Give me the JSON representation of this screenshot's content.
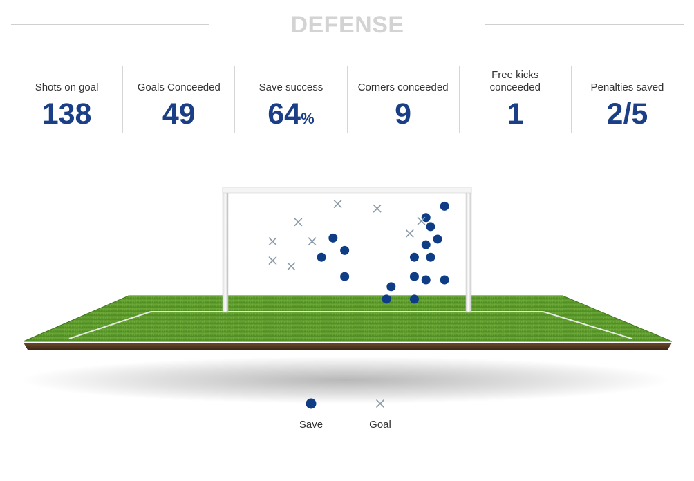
{
  "section": {
    "title": "DEFENSE"
  },
  "stats": [
    {
      "label": "Shots on goal",
      "value": "138",
      "unit": ""
    },
    {
      "label": "Goals Conceeded",
      "value": "49",
      "unit": ""
    },
    {
      "label": "Save success",
      "value": "64",
      "unit": "%"
    },
    {
      "label": "Corners conceeded",
      "value": "9",
      "unit": ""
    },
    {
      "label": "Free kicks conceeded",
      "value": "1",
      "unit": ""
    },
    {
      "label": "Penalties saved",
      "value": "2/5",
      "unit": ""
    }
  ],
  "colors": {
    "accent": "#1b3f86",
    "save_marker": "#0e3d86",
    "goal_marker": "#8a9aa8",
    "title": "#d3d3d3",
    "grass": "#5e9a2c",
    "soil": "#5a3a22"
  },
  "legend": {
    "save_label": "Save",
    "goal_label": "Goal"
  },
  "chart_data": {
    "type": "scatter",
    "title": "",
    "xlabel": "",
    "ylabel": "",
    "xlim": [
      0,
      1
    ],
    "ylim": [
      0,
      1
    ],
    "grid": false,
    "legend_position": "bottom-center",
    "series": [
      {
        "name": "Save",
        "marker": "circle",
        "color": "#0e3d86",
        "points": [
          {
            "x": 0.92,
            "y": 0.9
          },
          {
            "x": 0.84,
            "y": 0.8
          },
          {
            "x": 0.86,
            "y": 0.72
          },
          {
            "x": 0.89,
            "y": 0.61
          },
          {
            "x": 0.84,
            "y": 0.56
          },
          {
            "x": 0.79,
            "y": 0.45
          },
          {
            "x": 0.86,
            "y": 0.45
          },
          {
            "x": 0.79,
            "y": 0.28
          },
          {
            "x": 0.84,
            "y": 0.25
          },
          {
            "x": 0.92,
            "y": 0.25
          },
          {
            "x": 0.69,
            "y": 0.19
          },
          {
            "x": 0.67,
            "y": 0.08
          },
          {
            "x": 0.79,
            "y": 0.08
          },
          {
            "x": 0.44,
            "y": 0.62
          },
          {
            "x": 0.49,
            "y": 0.51
          },
          {
            "x": 0.39,
            "y": 0.45
          },
          {
            "x": 0.49,
            "y": 0.28
          }
        ]
      },
      {
        "name": "Goal",
        "marker": "cross",
        "color": "#8a9aa8",
        "points": [
          {
            "x": 0.46,
            "y": 0.92
          },
          {
            "x": 0.63,
            "y": 0.88
          },
          {
            "x": 0.29,
            "y": 0.76
          },
          {
            "x": 0.82,
            "y": 0.77
          },
          {
            "x": 0.77,
            "y": 0.66
          },
          {
            "x": 0.18,
            "y": 0.59
          },
          {
            "x": 0.35,
            "y": 0.59
          },
          {
            "x": 0.18,
            "y": 0.42
          },
          {
            "x": 0.26,
            "y": 0.37
          }
        ]
      }
    ]
  }
}
